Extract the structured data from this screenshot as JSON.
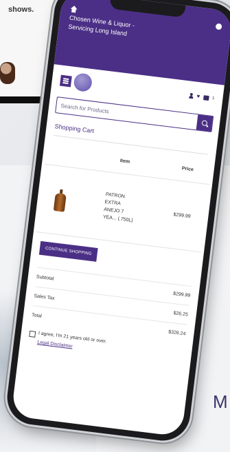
{
  "background": {
    "caption": "shows.",
    "side_letter": "M"
  },
  "header": {
    "store_name": "Chosen Wine & Liquor - Servicing Long Island"
  },
  "icons_row": {
    "cart_count": "1"
  },
  "search": {
    "placeholder": "Search for Products"
  },
  "page": {
    "title": "Shopping Cart"
  },
  "cart": {
    "headers": {
      "item": "Item",
      "price": "Price"
    },
    "items": [
      {
        "name": "PATRON EXTRA ANEJO 7 YEA... (.750L)",
        "price": "$299.99"
      }
    ]
  },
  "actions": {
    "continue": "CONTINUE SHOPPING"
  },
  "totals": {
    "subtotal_label": "Subtotal",
    "subtotal_value": "$299.99",
    "tax_label": "Sales Tax",
    "tax_value": "$26.25",
    "total_label": "Total",
    "total_value": "$326.24"
  },
  "agreement": {
    "text": "I agree, I'm 21 years old or over.",
    "link": "Legal Disclaimer"
  },
  "colors": {
    "brand": "#4b2f86"
  }
}
